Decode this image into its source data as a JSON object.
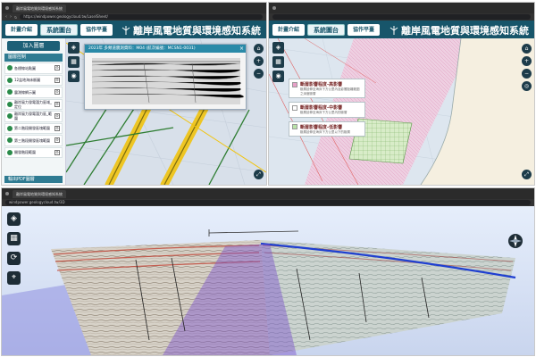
{
  "panel_top_left": {
    "tab_title": "離岸風電地質與環境感知系統",
    "url": "https://windpower.geologycloud.tw/LaselSheet/",
    "nav": [
      {
        "label": "計畫介紹"
      },
      {
        "label": "系統圖台"
      },
      {
        "label": "協作平臺"
      }
    ],
    "app_title": "離岸風電地質與環境感知系統",
    "add_layer": "加入圖層",
    "layer_header": "圖層控制",
    "layers": [
      {
        "label": "各標線站點圖"
      },
      {
        "label": "12盆地海床斷圖"
      },
      {
        "label": "震測線網示圖"
      },
      {
        "label": "離岸風力發電潛力區域_定位"
      },
      {
        "label": "離岸風力發電潛力區_範圍"
      },
      {
        "label": "第二階段開發區塊範圍"
      },
      {
        "label": "第三階段開發區塊範圍"
      },
      {
        "label": "開發階段範圍"
      }
    ],
    "pdf_bar": "輸出PDF圖層",
    "popup_title": "2023年 多頻道震測資料：M04 (航次編號：MCSN1-0031)"
  },
  "panel_top_right": {
    "nav": [
      {
        "label": "計畫介紹"
      },
      {
        "label": "系統圖台"
      },
      {
        "label": "協作平臺"
      }
    ],
    "app_title": "離岸風電地質與環境感知系統",
    "legend": [
      {
        "title": "斷層影響程度-高影響",
        "desc": "斷層延伸至海床下方公里內及影響距離範圍之深度斷層",
        "color": "#e8a0c8"
      },
      {
        "title": "斷層影響程度-中影響",
        "desc": "斷層延伸至海床下方公里內的斷層",
        "color": "#ffffff"
      },
      {
        "title": "斷層影響程度-低影響",
        "desc": "斷層延伸至海床下方公里以下的斷層",
        "color": "#b9e3a8"
      }
    ]
  },
  "panel_bottom": {
    "tab_title": "離岸風電地質與環境感知系統",
    "url": "windpower.geologycloud.tw/3D"
  }
}
